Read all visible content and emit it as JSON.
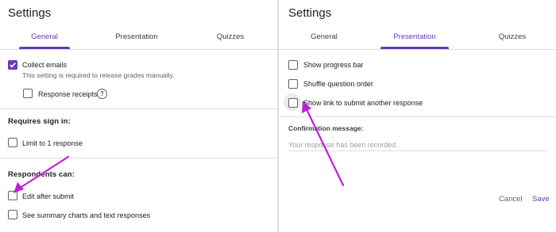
{
  "left": {
    "title": "Settings",
    "tabs": [
      {
        "label": "General",
        "active": true
      },
      {
        "label": "Presentation",
        "active": false
      },
      {
        "label": "Quizzes",
        "active": false
      }
    ],
    "collect_emails": {
      "label": "Collect emails",
      "checked": true
    },
    "collect_emails_hint": "This setting is required to release grades manually.",
    "response_receipts": {
      "label": "Response receipts",
      "checked": false
    },
    "requires_sign_in": "Requires sign in:",
    "limit_one_response": {
      "label": "Limit to 1 response",
      "checked": false
    },
    "respondents_can": "Respondents can:",
    "edit_after_submit": {
      "label": "Edit after submit",
      "checked": false
    },
    "see_summary": {
      "label": "See summary charts and text responses",
      "checked": false
    }
  },
  "right": {
    "title": "Settings",
    "tabs": [
      {
        "label": "General",
        "active": false
      },
      {
        "label": "Presentation",
        "active": true
      },
      {
        "label": "Quizzes",
        "active": false
      }
    ],
    "show_progress_bar": {
      "label": "Show progress bar",
      "checked": false
    },
    "shuffle_question_order": {
      "label": "Shuffle question order",
      "checked": false
    },
    "show_link": {
      "label": "Show link to submit another response",
      "checked": false
    },
    "confirmation_label": "Confirmation message:",
    "confirmation_placeholder": "Your response has been recorded.",
    "cancel_label": "Cancel",
    "save_label": "Save"
  },
  "colors": {
    "accent": "#673ab7",
    "annotation_arrow": "#c020d8"
  },
  "icons": {
    "help": "question-circle-icon",
    "check": "checkmark-icon"
  }
}
